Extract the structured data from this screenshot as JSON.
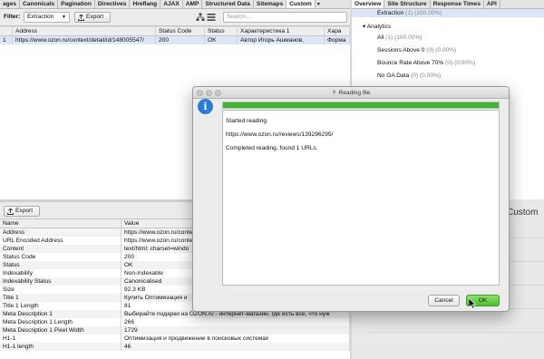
{
  "top_tabs": [
    "ages",
    "Canonicals",
    "Pagination",
    "Directives",
    "Hreflang",
    "AJAX",
    "AMP",
    "Structured Data",
    "Sitemaps",
    "Custom"
  ],
  "active_top_tab": "Custom",
  "toolbar": {
    "filter_label": "Filter:",
    "filter_value": "Extraction",
    "export_label": "Export",
    "search_placeholder": "Search..."
  },
  "main_table": {
    "columns": [
      "",
      "Address",
      "Status Code",
      "Status",
      "Характеристика 1",
      "Хара"
    ],
    "rows": [
      [
        "1",
        "https://www.ozon.ru/context/detail/id/148005547/",
        "200",
        "OK",
        "Автор   Игорь Ашманов,",
        "Форма"
      ]
    ]
  },
  "lower": {
    "export_label": "Export",
    "columns": [
      "Name",
      "Value"
    ],
    "rows": [
      [
        "Address",
        "https://www.ozon.ru/conte"
      ],
      [
        "URL Encoded Address",
        "https://www.ozon.ru/conte"
      ],
      [
        "Content",
        "text/html; charset=windo"
      ],
      [
        "Status Code",
        "200"
      ],
      [
        "Status",
        "OK"
      ],
      [
        "Indexability",
        "Non-Indexable"
      ],
      [
        "Indexability Status",
        "Canonicalised"
      ],
      [
        "Size",
        "92.3 KB"
      ],
      [
        "Title 1",
        "Купить Оптимизация и"
      ],
      [
        "Title 1 Length",
        "81"
      ],
      [
        "Meta Description 1",
        "Выбирайте подарки на OZON.ru - интернет-магазин, где есть всё, что нуж"
      ],
      [
        "Meta Description 1 Length",
        "266"
      ],
      [
        "Meta Description 1 Pixel Width",
        "1729"
      ],
      [
        "H1-1",
        "Оптимизация и продвижение в поисковых системах"
      ],
      [
        "H1-1 length",
        "46"
      ]
    ]
  },
  "right_tabs": [
    "Overview",
    "Site Structure",
    "Response Times",
    "API"
  ],
  "right_panel": {
    "extraction_label": "Extraction",
    "extraction_stats": "(1) (100.00%)",
    "analytics_label": "Analytics",
    "items": [
      {
        "label": "All",
        "stats": "(1) (100.00%)"
      },
      {
        "label": "Sessions Above 0",
        "stats": "(0) (0.00%)"
      },
      {
        "label": "Bounce Rate Above 70%",
        "stats": "(0) (0.00%)"
      },
      {
        "label": "No GA Data",
        "stats": "(0) (0.00%)"
      }
    ],
    "custom_label": "Custom"
  },
  "dialog": {
    "title": "Reading file",
    "progress_fraction": 1.0,
    "lines": [
      "Started reading",
      "https://www.ozon.ru/reviews/139296295/",
      "Completed reading, found 1 URLs."
    ],
    "cancel_label": "Cancel",
    "ok_label": "OK"
  },
  "colors": {
    "progress": "#3fb62f",
    "ok_button": "#4fbf32",
    "info_icon": "#2c7bd6",
    "selected_row": "#dbe6f6"
  }
}
